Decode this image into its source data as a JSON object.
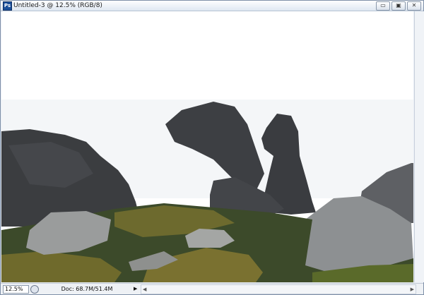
{
  "window": {
    "title": "Untitled-3 @ 12.5% (RGB/8)",
    "app_icon_label": "Ps",
    "buttons": {
      "minimize": "▭",
      "maximize": "▣",
      "close": "✕"
    }
  },
  "canvas": {
    "icon_name": "photo-rock-birds"
  },
  "status": {
    "zoom": "12.5%",
    "doc_info": "Doc: 68.7M/51.4M",
    "arrow": "▶",
    "scroll_left": "◀",
    "scroll_right": "▶"
  }
}
